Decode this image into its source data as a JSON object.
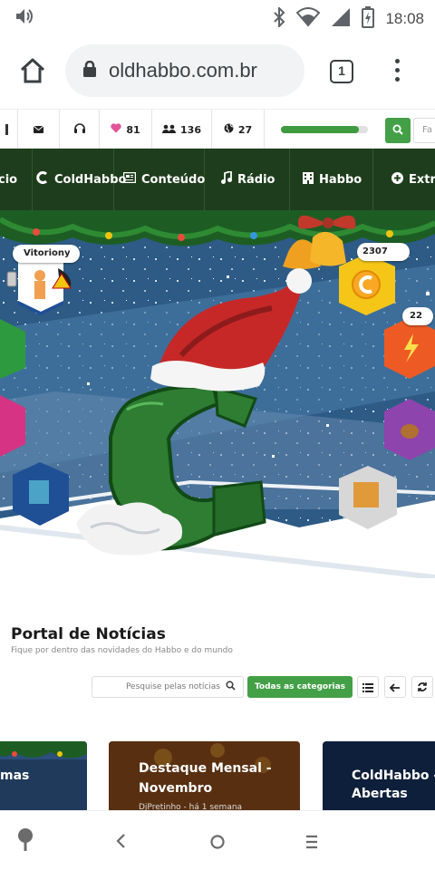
{
  "status_bar": {
    "time": "18:08"
  },
  "browser": {
    "url": "oldhabbo.com.br",
    "tab_count": "1"
  },
  "stats": {
    "likes": "81",
    "friends": "136",
    "online": "27",
    "progress": 0.9,
    "search_placeholder": "Fa"
  },
  "nav": {
    "items": [
      {
        "label": "cio"
      },
      {
        "label": "ColdHabbo"
      },
      {
        "label": "Conteúdo"
      },
      {
        "label": "Rádio"
      },
      {
        "label": "Habbo"
      },
      {
        "label": "Extr"
      }
    ]
  },
  "hero": {
    "username": "Vitoriony",
    "coins": "2307",
    "gems": "22"
  },
  "portal": {
    "title": "Portal de Notícias",
    "subtitle": "Fique por dentro das novidades do Habbo e do mundo",
    "search_placeholder": "Pesquise pelas notícias",
    "category_button": "Todas as categorias",
    "cards": [
      {
        "title": "mas"
      },
      {
        "title_line1": "Destaque Mensal -",
        "title_line2": "Novembro",
        "meta": "DjPretinho - há 1 semana"
      },
      {
        "title_line1": "ColdHabbo -",
        "title_line2": "Abertas"
      }
    ]
  },
  "colors": {
    "accent_green": "#43a047",
    "nav_bg": "#1e3d1c",
    "like": "#e05596"
  }
}
